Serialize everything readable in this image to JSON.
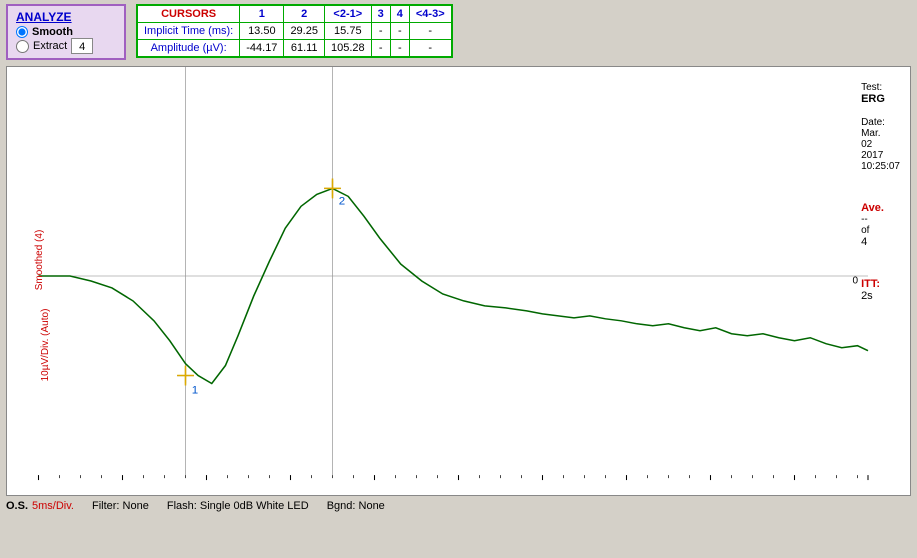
{
  "analyze": {
    "title": "ANALYZE",
    "smooth_label": "Smooth",
    "extract_label": "Extract",
    "smooth_selected": true,
    "extract_number": "4"
  },
  "cursors": {
    "header": "CURSORS",
    "columns": [
      "1",
      "2",
      "<2-1>",
      "3",
      "4",
      "<4-3>"
    ],
    "rows": [
      {
        "label": "Implicit Time (ms):",
        "values": [
          "13.50",
          "29.25",
          "15.75",
          "-",
          "-",
          "-"
        ]
      },
      {
        "label": "Amplitude (µV):",
        "values": [
          "-44.17",
          "61.11",
          "105.28",
          "-",
          "-",
          "-"
        ]
      }
    ]
  },
  "chart": {
    "y_axis_label": "10µV/Div. (Auto)",
    "y_axis_side_label": "Smoothed (4)",
    "zero_label": "0",
    "test_label": "Test:",
    "test_value": "ERG",
    "date_label": "Date:",
    "date_value": "Mar.\n02\n2017",
    "time_value": "10:25:07",
    "ave_label": "Ave.",
    "ave_dashes": "--",
    "ave_of": "of",
    "ave_count": "4",
    "itt_label": "ITT:",
    "itt_value": "2s",
    "cursor1_label": "1",
    "cursor2_label": "2"
  },
  "status_bar": {
    "os_label": "O.S.",
    "items": [
      {
        "label": "5ms/Div.",
        "color": "red"
      },
      {
        "label": "Filter: None",
        "color": "black"
      },
      {
        "label": "Flash: Single 0dB White LED",
        "color": "black"
      },
      {
        "label": "Bgnd: None",
        "color": "black"
      }
    ]
  }
}
